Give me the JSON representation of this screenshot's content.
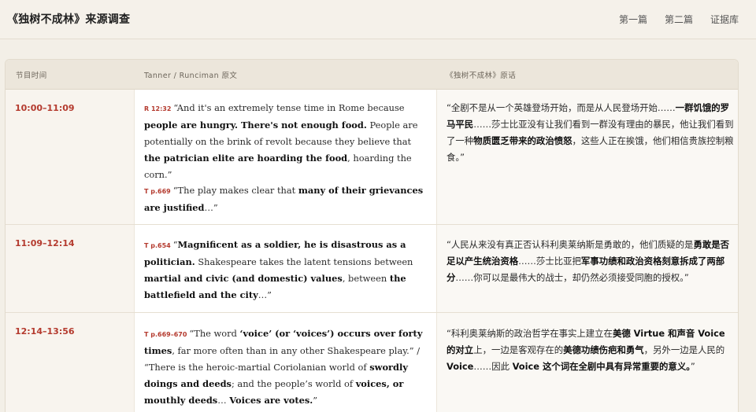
{
  "header": {
    "title": "《独树不成林》来源调查",
    "nav": [
      "第一篇",
      "第二篇",
      "证据库"
    ]
  },
  "table": {
    "columns": [
      "节目时间",
      "Tanner / Runciman 原文",
      "《独树不成林》原话"
    ],
    "rows": [
      {
        "time": "10:00–11:09",
        "source": [
          {
            "ref": "R 12:32",
            "parts": [
              {
                "t": "“And it's an extremely tense time in Rome because "
              },
              {
                "t": "people are hungry. There's not enough food.",
                "b": true
              },
              {
                "t": " People are potentially on the brink of revolt because they believe that "
              },
              {
                "t": "the patrician elite are hoarding the food",
                "b": true
              },
              {
                "t": ", hoarding the corn.”"
              }
            ]
          },
          {
            "ref": "T p.669",
            "parts": [
              {
                "t": "“The play makes clear that "
              },
              {
                "t": "many of their grievances are justified",
                "b": true
              },
              {
                "t": "…”"
              }
            ]
          }
        ],
        "quote": [
          {
            "t": "“全剧不是从一个英雄登场开始，而是从人民登场开始……"
          },
          {
            "t": "一群饥饿的罗马平民",
            "b": true
          },
          {
            "t": "……莎士比亚没有让我们看到一群没有理由的暴民，他让我们看到了一种"
          },
          {
            "t": "物质匮乏带来的政治愤怒",
            "b": true
          },
          {
            "t": "，这些人正在挨饿，他们相信贵族控制粮食。”"
          }
        ]
      },
      {
        "time": "11:09–12:14",
        "source": [
          {
            "ref": "T p.654",
            "parts": [
              {
                "t": "“"
              },
              {
                "t": "Magnificent as a soldier, he is disastrous as a politician.",
                "b": true
              },
              {
                "t": " Shakespeare takes the latent tensions between "
              },
              {
                "t": "martial and civic (and domestic) values",
                "b": true
              },
              {
                "t": ", between "
              },
              {
                "t": "the battlefield and the city",
                "b": true
              },
              {
                "t": "…”"
              }
            ]
          }
        ],
        "quote": [
          {
            "t": "“人民从来没有真正否认科利奥莱纳斯是勇敢的，他们质疑的是"
          },
          {
            "t": "勇敢是否足以产生统治资格",
            "b": true
          },
          {
            "t": "……莎士比亚把"
          },
          {
            "t": "军事功绩和政治资格刻意拆成了两部分",
            "b": true
          },
          {
            "t": "……你可以是最伟大的战士，却仍然必须接受同胞的授权。”"
          }
        ]
      },
      {
        "time": "12:14–13:56",
        "source": [
          {
            "ref": "T p.669–670",
            "parts": [
              {
                "t": "“The word "
              },
              {
                "t": "‘voice’ (or ‘voices’) occurs over forty times",
                "b": true
              },
              {
                "t": ", far more often than in any other Shakespeare play.” / “There is the heroic-martial Coriolanian world of "
              },
              {
                "t": "swordly doings and deeds",
                "b": true
              },
              {
                "t": "; and the people’s world of "
              },
              {
                "t": "voices, or mouthly deeds",
                "b": true
              },
              {
                "t": "… "
              },
              {
                "t": "Voices are votes.",
                "b": true
              },
              {
                "t": "”"
              }
            ]
          }
        ],
        "quote": [
          {
            "t": "“科利奥莱纳斯的政治哲学在事实上建立在"
          },
          {
            "t": "美德 Virtue 和声音 Voice 的对立",
            "b": true
          },
          {
            "t": "上，一边是客观存在的"
          },
          {
            "t": "美德功绩伤疤和勇气",
            "b": true
          },
          {
            "t": "，另外一边是人民的 "
          },
          {
            "t": "Voice",
            "b": true
          },
          {
            "t": "……因此 "
          },
          {
            "t": "Voice 这个词在全剧中具有异常重要的意义。",
            "b": true
          },
          {
            "t": "”"
          }
        ]
      }
    ]
  }
}
